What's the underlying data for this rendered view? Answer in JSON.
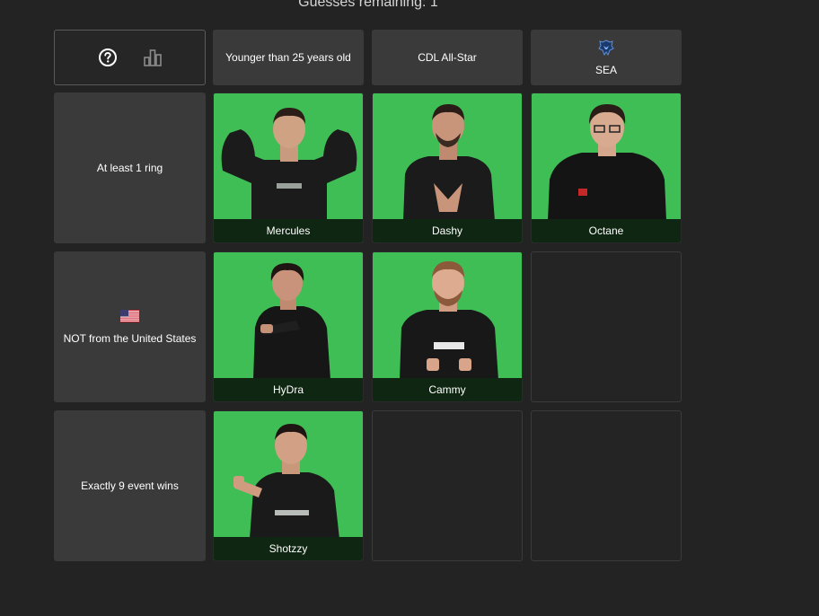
{
  "status": {
    "guesses_remaining": "Guesses remaining: 1"
  },
  "toolbar": {
    "help_icon": "help-icon",
    "stats_icon": "bar-chart-icon"
  },
  "columns": [
    {
      "label": "Younger than 25 years old"
    },
    {
      "label": "CDL All-Star"
    },
    {
      "label": "SEA",
      "icon": "seattle-team-logo-icon"
    }
  ],
  "rows": [
    {
      "label": "At least 1 ring"
    },
    {
      "label": "NOT from the United States",
      "icon": "us-flag-icon"
    },
    {
      "label": "Exactly 9 event wins"
    }
  ],
  "cells": [
    [
      "Mercules",
      "Dashy",
      "Octane"
    ],
    [
      "HyDra",
      "Cammy",
      ""
    ],
    [
      "Shotzzy",
      "",
      ""
    ]
  ],
  "colors": {
    "background": "#232323",
    "header_cell": "#3a3a3a",
    "correct_cell": "#3fbe55",
    "name_bar": "#0f2612"
  }
}
